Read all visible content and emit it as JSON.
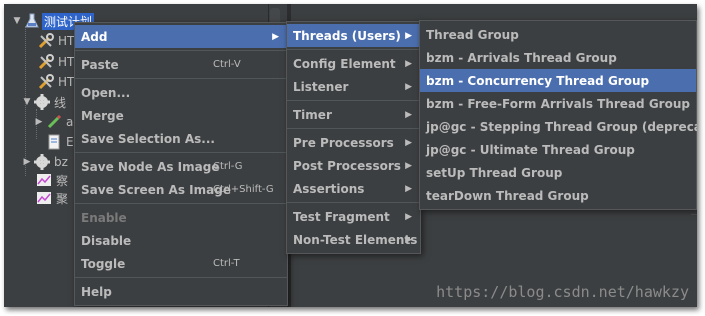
{
  "tree": {
    "items": [
      {
        "label": "测试计划",
        "icon": "test-plan-icon"
      },
      {
        "label": "HT",
        "icon": "wrench-icon"
      },
      {
        "label": "HT",
        "icon": "wrench-icon"
      },
      {
        "label": "HT",
        "icon": "wrench-icon"
      },
      {
        "label": "线",
        "icon": "gear-icon"
      },
      {
        "label": "a",
        "icon": "pencil-icon"
      },
      {
        "label": "E",
        "icon": "document-icon"
      },
      {
        "label": "bz",
        "icon": "gear-icon"
      },
      {
        "label": "察",
        "icon": "graph-icon"
      },
      {
        "label": "聚",
        "icon": "graph-icon"
      }
    ]
  },
  "context_menu": {
    "add": "Add",
    "paste": "Paste",
    "paste_shortcut": "Ctrl-V",
    "open": "Open...",
    "merge": "Merge",
    "save_selection_as": "Save Selection As...",
    "save_node_as_image": "Save Node As Image",
    "save_node_shortcut": "Ctrl-G",
    "save_screen_as_image": "Save Screen As Image",
    "save_screen_shortcut": "Ctrl+Shift-G",
    "enable": "Enable",
    "disable": "Disable",
    "toggle": "Toggle",
    "toggle_shortcut": "Ctrl-T",
    "help": "Help"
  },
  "add_submenu": {
    "threads": "Threads (Users)",
    "config_element": "Config Element",
    "listener": "Listener",
    "timer": "Timer",
    "pre_processors": "Pre Processors",
    "post_processors": "Post Processors",
    "assertions": "Assertions",
    "test_fragment": "Test Fragment",
    "non_test_elements": "Non-Test Elements"
  },
  "threads_submenu": {
    "items": [
      "Thread Group",
      "bzm - Arrivals Thread Group",
      "bzm - Concurrency Thread Group",
      "bzm - Free-Form Arrivals Thread Group",
      "jp@gc - Stepping Thread Group (deprecated)",
      "jp@gc - Ultimate Thread Group",
      "setUp Thread Group",
      "tearDown Thread Group"
    ],
    "highlighted_index": 2
  },
  "watermark": "https://blog.csdn.net/hawkzy",
  "colors": {
    "background": "#3c3f41",
    "highlight": "#4b6eaf",
    "selection": "#2f65ca",
    "text": "#bbbbbb"
  }
}
